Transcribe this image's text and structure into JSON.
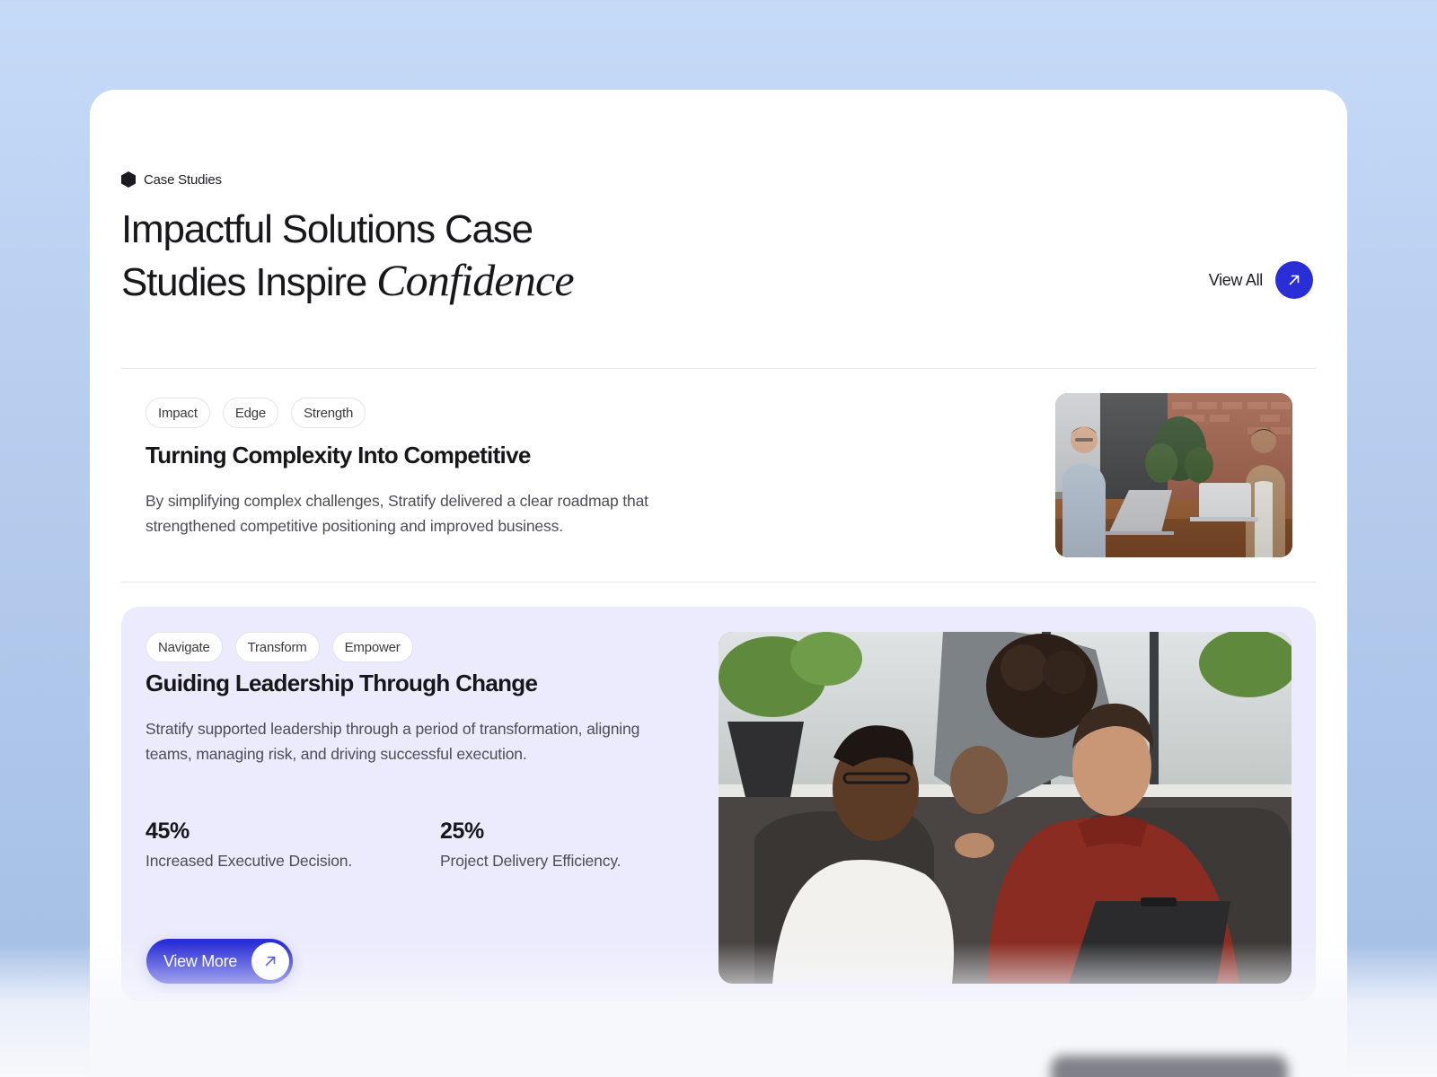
{
  "section": {
    "eyebrow": "Case Studies",
    "headline_line1": "Impactful Solutions Case",
    "headline_line2": "Studies Inspire",
    "headline_italic": "Confidence",
    "view_all_label": "View All"
  },
  "cases": [
    {
      "tags": [
        "Impact",
        "Edge",
        "Strength"
      ],
      "title": "Turning Complexity Into Competitive",
      "description": "By simplifying complex challenges, Stratify delivered a clear roadmap that strengthened competitive positioning and improved business."
    },
    {
      "tags": [
        "Navigate",
        "Transform",
        "Empower"
      ],
      "title": "Guiding Leadership Through Change",
      "description": "Stratify supported leadership through a period of transformation, aligning teams, managing risk, and driving successful execution.",
      "stats": [
        {
          "value": "45%",
          "label": "Increased Executive Decision."
        },
        {
          "value": "25%",
          "label": "Project Delivery Efficiency."
        }
      ],
      "button_label": "View More"
    }
  ],
  "colors": {
    "accent": "#2a2ed6",
    "featured_bg": "#ecebfd",
    "page_bg": "#c6daf8"
  },
  "icons": {
    "eyebrow": "hexagon-icon",
    "view_all": "arrow-up-right-icon",
    "view_more": "arrow-up-right-icon"
  }
}
